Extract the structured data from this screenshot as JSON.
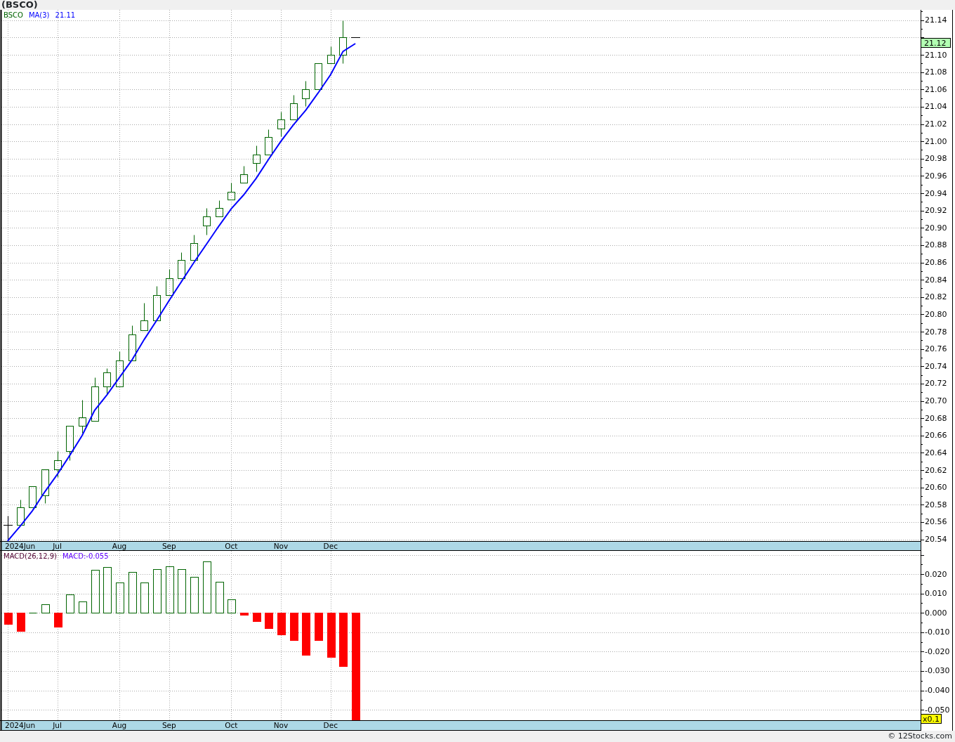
{
  "title": "(BSCO)",
  "price_chart": {
    "ma_value": "21.11",
    "chart_data": {
      "type": "candlestick",
      "title": "BSCO",
      "grid": true,
      "categories": [
        null,
        "2024Jun",
        null,
        null,
        "Jul",
        null,
        null,
        null,
        null,
        "Aug",
        null,
        null,
        null,
        "Sep",
        null,
        null,
        null,
        null,
        "Oct",
        null,
        null,
        null,
        "Nov",
        null,
        null,
        null,
        "Dec",
        null,
        null,
        null,
        null,
        null,
        null,
        null,
        null,
        null,
        null,
        null,
        null,
        null,
        null,
        null,
        null,
        null,
        null,
        null,
        null,
        null,
        null,
        null,
        null,
        null,
        null,
        null,
        null,
        null,
        null,
        null,
        null,
        null,
        null,
        null,
        null,
        null,
        null,
        null,
        null,
        null,
        null,
        null,
        null,
        null,
        null,
        null
      ],
      "ylim": [
        20.538,
        21.152
      ],
      "yticks": [
        {
          "value": 20.54,
          "label": "20.54"
        },
        {
          "value": 20.56,
          "label": "20.56"
        },
        {
          "value": 20.58,
          "label": "20.58"
        },
        {
          "value": 20.6,
          "label": "20.60"
        },
        {
          "value": 20.62,
          "label": "20.62"
        },
        {
          "value": 20.64,
          "label": "20.64"
        },
        {
          "value": 20.66,
          "label": "20.66"
        },
        {
          "value": 20.68,
          "label": "20.68"
        },
        {
          "value": 20.7,
          "label": "20.70"
        },
        {
          "value": 20.72,
          "label": "20.72"
        },
        {
          "value": 20.74,
          "label": "20.74"
        },
        {
          "value": 20.76,
          "label": "20.76"
        },
        {
          "value": 20.78,
          "label": "20.78"
        },
        {
          "value": 20.8,
          "label": "20.80"
        },
        {
          "value": 20.82,
          "label": "20.82"
        },
        {
          "value": 20.84,
          "label": "20.84"
        },
        {
          "value": 20.86,
          "label": "20.86"
        },
        {
          "value": 20.88,
          "label": "20.88"
        },
        {
          "value": 20.9,
          "label": "20.90"
        },
        {
          "value": 20.92,
          "label": "20.92"
        },
        {
          "value": 20.94,
          "label": "20.94"
        },
        {
          "value": 20.96,
          "label": "20.96"
        },
        {
          "value": 20.98,
          "label": "20.98"
        },
        {
          "value": 21.0,
          "label": "21.00"
        },
        {
          "value": 21.02,
          "label": "21.02"
        },
        {
          "value": 21.04,
          "label": "21.04"
        },
        {
          "value": 21.06,
          "label": "21.06"
        },
        {
          "value": 21.08,
          "label": "21.08"
        },
        {
          "value": 21.1,
          "label": "21.10"
        },
        {
          "value": 21.14,
          "label": "21.14"
        }
      ],
      "ohlc": [
        [
          20.557,
          20.567,
          20.54,
          20.557
        ],
        [
          20.557,
          20.586,
          20.557,
          20.577
        ],
        [
          20.577,
          20.601,
          20.577,
          20.601
        ],
        [
          20.591,
          20.621,
          20.582,
          20.621
        ],
        [
          20.621,
          20.642,
          20.612,
          20.631
        ],
        [
          20.642,
          20.671,
          20.631,
          20.671
        ],
        [
          20.671,
          20.701,
          20.663,
          20.681
        ],
        [
          20.677,
          20.727,
          20.677,
          20.717
        ],
        [
          20.717,
          20.738,
          20.707,
          20.733
        ],
        [
          20.717,
          20.757,
          20.717,
          20.747
        ],
        [
          20.747,
          20.787,
          20.747,
          20.777
        ],
        [
          20.782,
          20.813,
          20.782,
          20.793
        ],
        [
          20.793,
          20.833,
          20.793,
          20.822
        ],
        [
          20.822,
          20.852,
          20.822,
          20.842
        ],
        [
          20.842,
          20.872,
          20.842,
          20.863
        ],
        [
          20.863,
          20.892,
          20.863,
          20.882
        ],
        [
          20.903,
          20.923,
          20.892,
          20.913
        ],
        [
          20.913,
          20.932,
          20.913,
          20.923
        ],
        [
          20.933,
          20.952,
          20.933,
          20.942
        ],
        [
          20.952,
          20.972,
          20.952,
          20.962
        ],
        [
          20.975,
          20.995,
          20.965,
          20.985
        ],
        [
          20.985,
          21.014,
          20.985,
          21.005
        ],
        [
          21.015,
          21.034,
          21.006,
          21.025
        ],
        [
          21.025,
          21.054,
          21.025,
          21.044
        ],
        [
          21.05,
          21.07,
          21.041,
          21.06
        ],
        [
          21.06,
          21.09,
          21.06,
          21.09
        ],
        [
          21.09,
          21.11,
          21.09,
          21.1
        ],
        [
          21.1,
          21.14,
          21.09,
          21.12
        ],
        [
          21.12,
          21.12,
          21.12,
          21.12
        ],
        null,
        null,
        null,
        null,
        null,
        null,
        null,
        null,
        null,
        null,
        null,
        null,
        null,
        null,
        null,
        null,
        null,
        null,
        null,
        null,
        null,
        null,
        null,
        null,
        null,
        null,
        null,
        null,
        null,
        null,
        null,
        null,
        null,
        null,
        null,
        null,
        null,
        null,
        null,
        null,
        null,
        null,
        null,
        null,
        null
      ],
      "series": [
        {
          "name": "MA(3)",
          "type": "line",
          "color": "#0000ff",
          "values": [
            20.538,
            20.555,
            20.573,
            20.595,
            20.615,
            20.637,
            20.66,
            20.689,
            20.707,
            20.727,
            20.747,
            20.771,
            20.793,
            20.816,
            20.838,
            20.86,
            20.881,
            20.902,
            20.922,
            20.938,
            20.957,
            20.979,
            21.0,
            21.019,
            21.036,
            21.056,
            21.077,
            21.104,
            21.113,
            null,
            null,
            null,
            null,
            null,
            null,
            null,
            null,
            null,
            null,
            null,
            null,
            null,
            null,
            null,
            null,
            null,
            null,
            null,
            null,
            null,
            null,
            null,
            null,
            null,
            null,
            null,
            null,
            null,
            null,
            null,
            null,
            null,
            null,
            null,
            null,
            null,
            null,
            null,
            null,
            null,
            null,
            null,
            null,
            null
          ]
        }
      ],
      "annotations": [
        "21.12"
      ]
    }
  },
  "macd_chart": {
    "reading": "MACD:-0.055",
    "scale_badge": "x0.1",
    "chart_data": {
      "type": "bar",
      "grid": true,
      "categories": [
        null,
        "2024Jun",
        null,
        null,
        "Jul",
        null,
        null,
        null,
        null,
        "Aug",
        null,
        null,
        null,
        "Sep",
        null,
        null,
        null,
        null,
        "Oct",
        null,
        null,
        null,
        "Nov",
        null,
        null,
        null,
        "Dec",
        null,
        null,
        null,
        null,
        null,
        null,
        null,
        null,
        null,
        null,
        null,
        null,
        null,
        null,
        null,
        null,
        null,
        null,
        null,
        null,
        null,
        null,
        null,
        null,
        null,
        null,
        null,
        null,
        null,
        null,
        null,
        null,
        null,
        null,
        null,
        null,
        null,
        null,
        null,
        null,
        null,
        null,
        null,
        null,
        null,
        null,
        null
      ],
      "ylim": [
        -0.0554,
        0.032
      ],
      "yticks": [
        {
          "value": 0.02,
          "label": "0.020"
        },
        {
          "value": 0.01,
          "label": "0.010"
        },
        {
          "value": 0,
          "label": "0.000"
        },
        {
          "value": -0.01,
          "label": "-0.010"
        },
        {
          "value": -0.02,
          "label": "-0.020"
        },
        {
          "value": -0.03,
          "label": "-0.030"
        },
        {
          "value": -0.04,
          "label": "-0.040"
        },
        {
          "value": -0.05,
          "label": "-0.050"
        }
      ],
      "series": [
        {
          "name": "MACD(26,12,9)",
          "color": "#006400",
          "values": [
            null,
            null,
            0,
            0.0043,
            null,
            0.0095,
            0.0059,
            0.0222,
            0.0236,
            0.0156,
            0.021,
            0.0156,
            0.0225,
            0.0239,
            0.0225,
            0.0185,
            0.0264,
            0.0159,
            0.0069,
            null,
            null,
            null,
            null,
            null,
            null,
            null,
            null,
            null,
            null,
            null,
            null,
            null,
            null,
            null,
            null,
            null,
            null,
            null,
            null,
            null,
            null,
            null,
            null,
            null,
            null,
            null,
            null,
            null,
            null,
            null,
            null,
            null,
            null,
            null,
            null,
            null,
            null,
            null,
            null,
            null,
            null,
            null,
            null,
            null,
            null,
            null,
            null,
            null,
            null,
            null,
            null,
            null,
            null,
            null
          ]
        },
        {
          "color": "#ff0000",
          "values": [
            -0.0058,
            -0.0094,
            null,
            null,
            -0.0072,
            null,
            null,
            null,
            null,
            null,
            null,
            null,
            null,
            null,
            null,
            null,
            null,
            null,
            null,
            -0.0011,
            -0.0043,
            -0.008,
            -0.0112,
            -0.0141,
            -0.0217,
            -0.0141,
            -0.0226,
            -0.0273,
            -0.055,
            null,
            null,
            null,
            null,
            null,
            null,
            null,
            null,
            null,
            null,
            null,
            null,
            null,
            null,
            null,
            null,
            null,
            null,
            null,
            null,
            null,
            null,
            null,
            null,
            null,
            null,
            null,
            null,
            null,
            null,
            null,
            null,
            null,
            null,
            null,
            null,
            null,
            null,
            null,
            null,
            null,
            null,
            null,
            null,
            null
          ]
        }
      ]
    }
  },
  "footer": "© 12Stocks.com"
}
